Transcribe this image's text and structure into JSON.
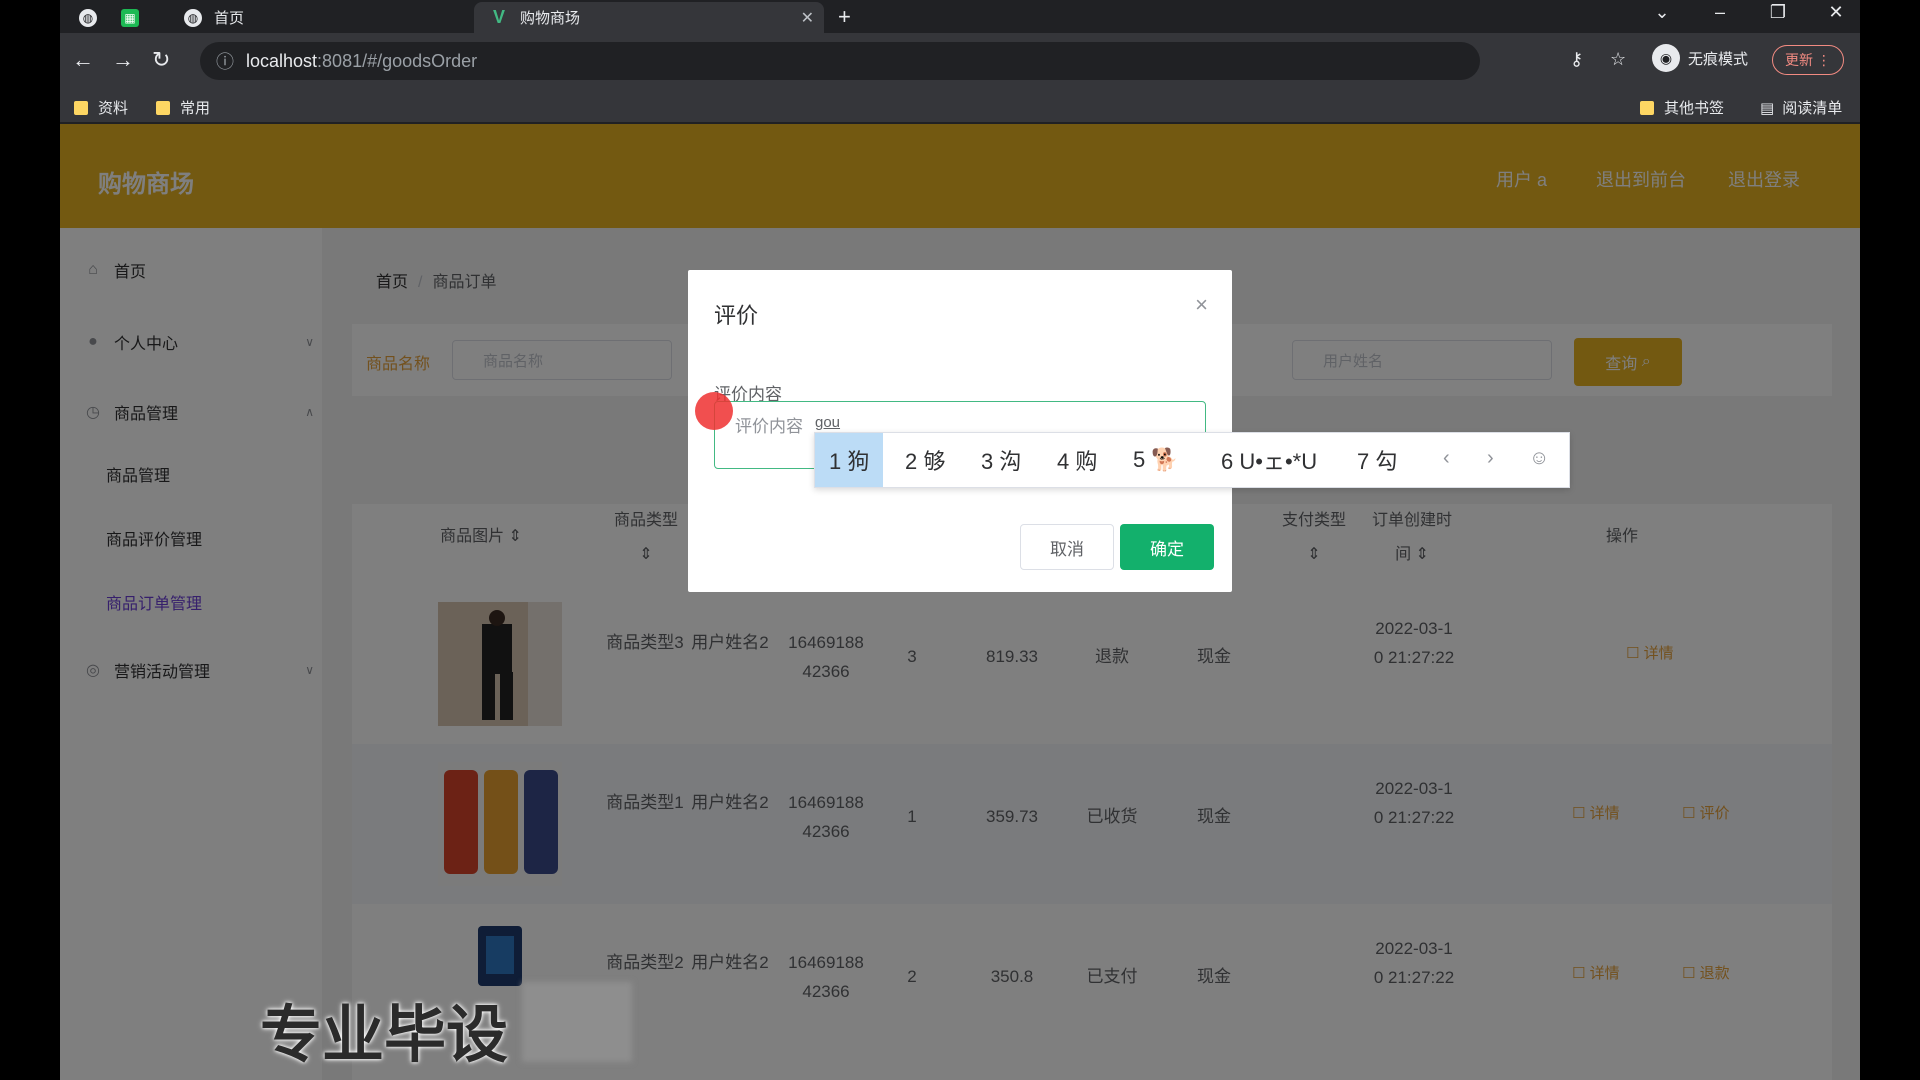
{
  "browser": {
    "tabs": [
      {
        "label": "首页",
        "active": false
      },
      {
        "label": "购物商场",
        "active": true
      }
    ],
    "url_host": "localhost",
    "url_path": ":8081/#/goodsOrder",
    "incognito_label": "无痕模式",
    "update_label": "更新",
    "bookmarks": [
      "资料",
      "常用"
    ],
    "bookmarks_right": [
      "其他书签",
      "阅读清单"
    ]
  },
  "app": {
    "title": "购物商场",
    "header_links": [
      "用户 a",
      "退出到前台",
      "退出登录"
    ],
    "colors": {
      "header": "#e6b322",
      "sidebar_active": "#6c3ed8",
      "confirm": "#13b06c"
    }
  },
  "sidebar": {
    "items": [
      {
        "label": "首页",
        "icon": "home-icon"
      },
      {
        "label": "个人中心",
        "icon": "user-icon"
      },
      {
        "label": "商品管理",
        "icon": "clock-icon"
      },
      {
        "label": "营销活动管理",
        "icon": "circle-icon"
      }
    ],
    "subitems": [
      "商品管理",
      "商品评价管理",
      "商品订单管理"
    ],
    "active_sub": "商品订单管理"
  },
  "main": {
    "breadcrumb": {
      "home": "首页",
      "current": "商品订单"
    },
    "search": {
      "label": "商品名称",
      "input1_placeholder": "商品名称",
      "input2_placeholder": "用户姓名",
      "button": "查询"
    },
    "table": {
      "headers": [
        "商品图片",
        "商品类型",
        "支付类型",
        "订单创建时间",
        "操作"
      ],
      "rows": [
        {
          "type": "商品类型3",
          "user": "用户姓名2",
          "order_no": "1646918842366",
          "qty": "3",
          "price": "819.33",
          "status": "退款",
          "pay": "现金",
          "created": "2022-03-10 21:27:22",
          "ops": [
            "详情"
          ]
        },
        {
          "type": "商品类型1",
          "user": "用户姓名2",
          "order_no": "1646918842366",
          "qty": "1",
          "price": "359.73",
          "status": "已收货",
          "pay": "现金",
          "created": "2022-03-10 21:27:22",
          "ops": [
            "详情",
            "评价"
          ]
        },
        {
          "type": "商品类型2",
          "user": "用户姓名2",
          "order_no": "1646918842366",
          "qty": "2",
          "price": "350.8",
          "status": "已支付",
          "pay": "现金",
          "created": "2022-03-10 21:27:22",
          "ops": [
            "详情",
            "退款"
          ]
        }
      ]
    }
  },
  "dialog": {
    "title": "评价",
    "close": "×",
    "field_label": "评价内容",
    "placeholder": "评价内容",
    "typed": "gou",
    "cancel": "取消",
    "confirm": "确定"
  },
  "ime": {
    "candidates": [
      "1 狗",
      "2 够",
      "3 沟",
      "4 购",
      "5 🐕",
      "6 U•ェ•*U",
      "7 勾"
    ],
    "selected_index": 0
  },
  "watermark": "专业毕设"
}
